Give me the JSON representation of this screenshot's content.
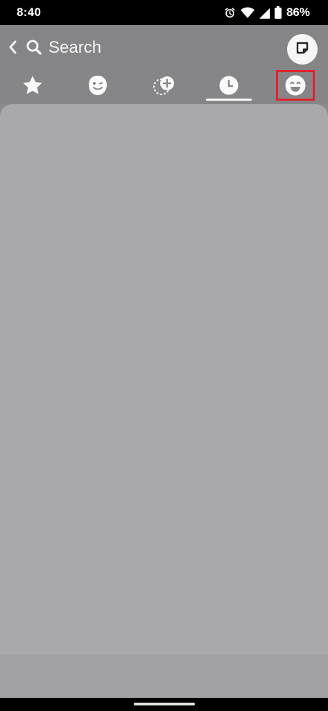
{
  "status_bar": {
    "time": "8:40",
    "battery_percent": "86%",
    "icons": [
      "alarm-icon",
      "wifi-icon",
      "signal-icon",
      "battery-icon"
    ]
  },
  "header": {
    "search_label": "Search",
    "icons": [
      "back-arrow-icon",
      "search-icon",
      "sticker-icon"
    ]
  },
  "tabs": [
    {
      "icon": "star-icon",
      "selected": false
    },
    {
      "icon": "bitmoji-face-icon",
      "selected": false
    },
    {
      "icon": "add-cameo-icon",
      "selected": false
    },
    {
      "icon": "clock-icon",
      "selected": true
    },
    {
      "icon": "smiley-icon",
      "selected": false,
      "highlighted": true
    }
  ],
  "colors": {
    "highlight": "#e0222a",
    "status_bar": "#000000",
    "panel": "#a9a9ab",
    "header": "#858587"
  }
}
